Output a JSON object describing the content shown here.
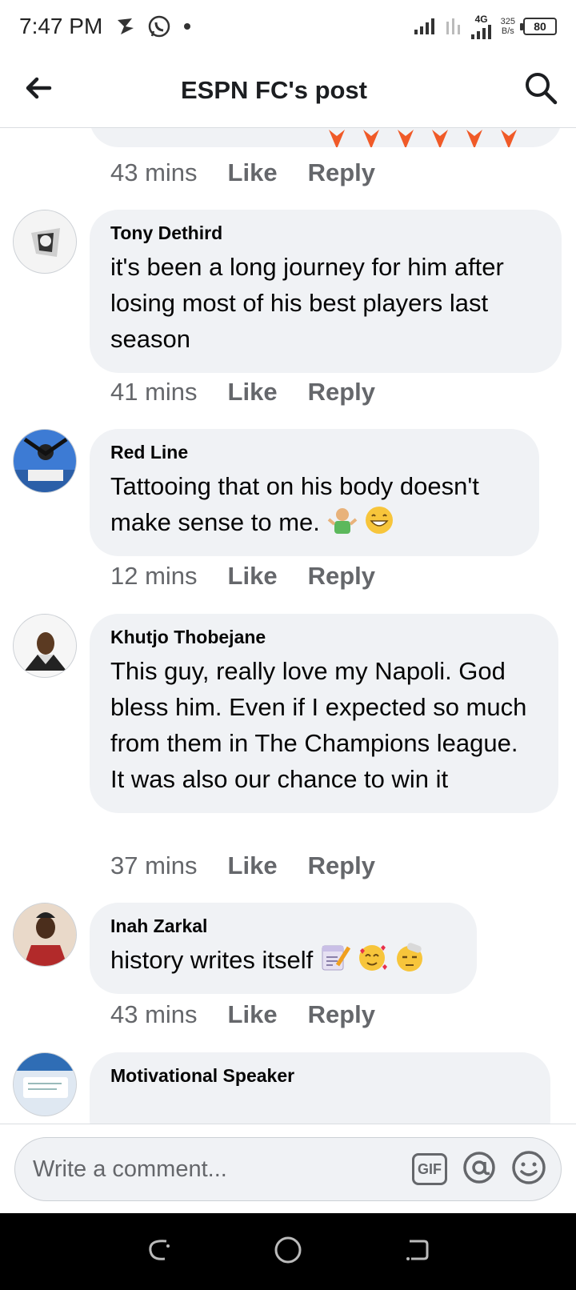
{
  "status": {
    "time": "7:47 PM",
    "net_rate": "325",
    "net_unit": "B/s",
    "net_type": "4G",
    "battery": "80"
  },
  "header": {
    "title": "ESPN FC's post"
  },
  "partial_comment": {
    "time": "43 mins",
    "like": "Like",
    "reply": "Reply"
  },
  "comments": [
    {
      "name": "Tony Dethird",
      "text": "it's been a long journey for him after losing most of his best players last season",
      "time": "41 mins",
      "like": "Like",
      "reply": "Reply"
    },
    {
      "name": "Red Line",
      "text": "Tattooing that on his body doesn't make sense to me.",
      "time": "12 mins",
      "like": "Like",
      "reply": "Reply"
    },
    {
      "name": "Khutjo Thobejane",
      "text": "This guy, really love my Napoli. God bless him. Even if I expected so much from them in The Champions league. It was also our chance to win it",
      "time": "37 mins",
      "like": "Like",
      "reply": "Reply"
    },
    {
      "name": "Inah Zarkal",
      "text": "history writes itself",
      "time": "43 mins",
      "like": "Like",
      "reply": "Reply"
    },
    {
      "name": "Motivational Speaker"
    }
  ],
  "composer": {
    "placeholder": "Write a comment...",
    "gif_label": "GIF"
  },
  "colors": {
    "bubble": "#f0f2f5",
    "meta": "#65676b",
    "text": "#050505"
  },
  "icons": [
    "back-arrow-icon",
    "search-icon",
    "gif-icon",
    "at-mention-icon",
    "emoji-icon",
    "recent-apps-icon",
    "home-icon",
    "back-nav-icon"
  ]
}
